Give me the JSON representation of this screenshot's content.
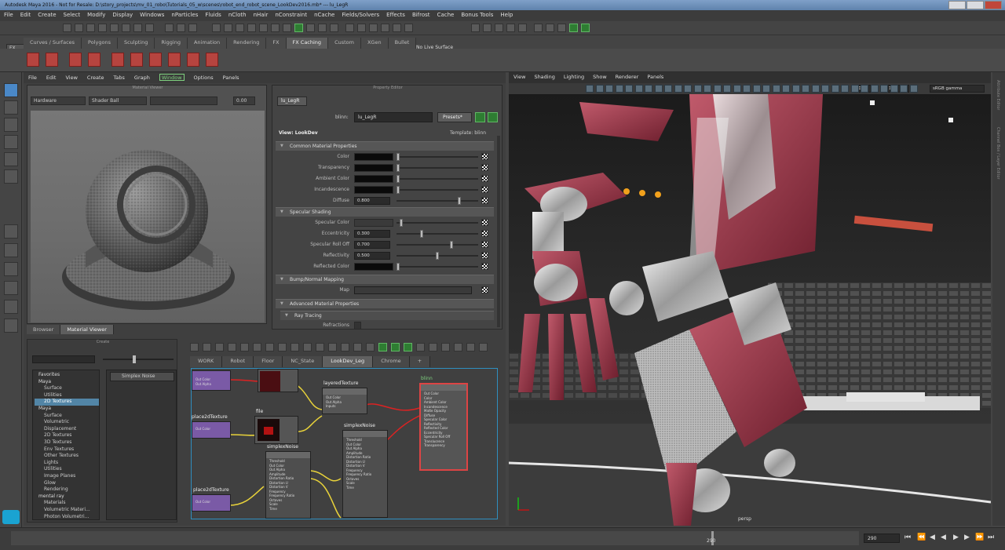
{
  "window": {
    "title": "Autodesk Maya 2016 - Not for Resale: D:\\story_projects\\mv_01_robo\\Tutorials_05_w\\scenes\\robot_end_robot_scene_LookDev2016.mb* --- lu_LegR"
  },
  "menubar": [
    "File",
    "Edit",
    "Create",
    "Select",
    "Modify",
    "Display",
    "Windows",
    "nParticles",
    "Fluids",
    "nCloth",
    "nHair",
    "nConstraint",
    "nCache",
    "Fields/Solvers",
    "Effects",
    "Bifrost",
    "Cache",
    "Bonus Tools",
    "Help"
  ],
  "toolbar": {
    "workspace": "FX",
    "live_surface": "No Live Surface"
  },
  "shelf_tabs": [
    "Curves / Surfaces",
    "Polygons",
    "Sculpting",
    "Rigging",
    "Animation",
    "Rendering",
    "FX",
    "FX Caching",
    "Custom",
    "XGen",
    "Bullet"
  ],
  "shelf_active": "FX Caching",
  "hypershade": {
    "menu": [
      "File",
      "Edit",
      "View",
      "Create",
      "Tabs",
      "Graph",
      "Window",
      "Options",
      "Panels"
    ],
    "material_viewer": {
      "title": "Material Viewer",
      "renderer": "Hardware",
      "shape": "Shader Ball",
      "value": "0.00"
    },
    "tabs": [
      "Browser",
      "Material Viewer"
    ],
    "tab_active": "Material Viewer",
    "create": {
      "title": "Create",
      "list": [
        {
          "label": "Favorites",
          "type": "h"
        },
        {
          "label": "Maya",
          "type": "h"
        },
        {
          "label": "Surface"
        },
        {
          "label": "Utilities"
        },
        {
          "label": "2D Textures",
          "type": "on"
        },
        {
          "label": "Maya",
          "type": "h"
        },
        {
          "label": "Surface"
        },
        {
          "label": "Volumetric"
        },
        {
          "label": "Displacement"
        },
        {
          "label": "2D Textures"
        },
        {
          "label": "3D Textures"
        },
        {
          "label": "Env Textures"
        },
        {
          "label": "Other Textures"
        },
        {
          "label": "Lights"
        },
        {
          "label": "Utilities"
        },
        {
          "label": "Image Planes"
        },
        {
          "label": "Glow"
        },
        {
          "label": "Rendering"
        },
        {
          "label": "mental ray",
          "type": "h"
        },
        {
          "label": "Materials"
        },
        {
          "label": "Volumetric Materi..."
        },
        {
          "label": "Photon Volumetri..."
        }
      ],
      "selected_node": "Simplex Noise"
    },
    "node_editor": {
      "tabs": [
        "WORK",
        "Robot",
        "Floor",
        "NC_State",
        "LookDev_Leg",
        "Chrome",
        "+"
      ],
      "tab_active": "LookDev_Leg"
    }
  },
  "property_editor": {
    "title": "Property Editor",
    "tab": "lu_LegR",
    "name_label": "blinn:",
    "name_value": "lu_LegR",
    "presets": "Presets*",
    "view_label": "View: LookDev",
    "template": "Template: blinn",
    "sections": {
      "common": "Common Material Properties",
      "specular": "Specular Shading",
      "bump": "Bump/Normal Mapping",
      "advanced": "Advanced Material Properties",
      "raytracing": "Ray Tracing"
    },
    "attrs": {
      "color": "Color",
      "transparency": "Transparency",
      "ambient": "Ambient Color",
      "incandescence": "Incandescence",
      "diffuse": "Diffuse",
      "diffuse_val": "0.800",
      "spec_color": "Specular Color",
      "eccentricity": "Eccentricity",
      "eccentricity_val": "0.300",
      "rolloff": "Specular Roll Off",
      "rolloff_val": "0.700",
      "reflectivity": "Reflectivity",
      "reflectivity_val": "0.500",
      "reflected": "Reflected Color",
      "map": "Map",
      "refractions": "Refractions"
    }
  },
  "nodes": {
    "layered": "layeredTexture",
    "place1": "place2dTexture",
    "file": "file",
    "simplex1": "simplexNoise",
    "simplex2": "simplexNoise",
    "place2": "place2dTexture",
    "blinn": "blinn",
    "ports_out": [
      "Out Color",
      "Out Alpha"
    ],
    "ports_layer": [
      "Out Color",
      "Out Alpha",
      "Inputs"
    ],
    "ports_noise": [
      "Threshold",
      "Out Color",
      "Out Alpha",
      "Amplitude",
      "Distortion Ratio",
      "Distortion U",
      "Distortion V",
      "Frequency",
      "Frequency Ratio",
      "Octaves",
      "Scale",
      "Time"
    ],
    "ports_blinn": [
      "Out Color",
      "Color",
      "Ambient Color",
      "Incandescence",
      "Matte Opacity",
      "Diffuse",
      "Specular Color",
      "Reflectivity",
      "Reflected Color",
      "Eccentricity",
      "Specular Roll Off",
      "Translucence",
      "Transparency"
    ]
  },
  "viewport": {
    "menu": [
      "View",
      "Shading",
      "Lighting",
      "Show",
      "Renderer",
      "Panels"
    ],
    "v1": "0.00",
    "v2": "1.00",
    "colorspace": "sRGB gamma",
    "camera": "persp"
  },
  "right_edge": [
    "Attribute Editor",
    "Channel Box / Layer Editor"
  ],
  "timeline": {
    "current": "290",
    "end": "290"
  },
  "colors": {
    "accent": "#4a88c7",
    "active_green": "#7fd27f",
    "selected_blue": "#5285a6",
    "robot_red": "#9c3548"
  }
}
